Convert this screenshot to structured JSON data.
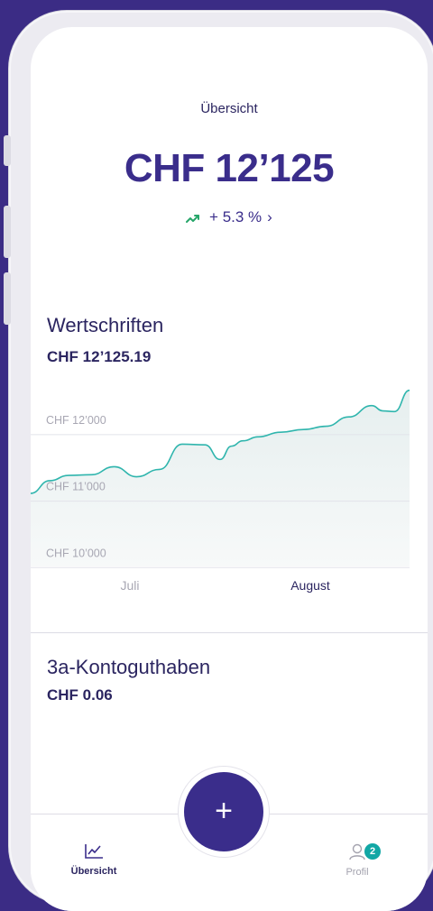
{
  "header": {
    "title": "Übersicht"
  },
  "portfolio": {
    "total": "CHF 12’125",
    "change": "+ 5.3 %",
    "chevron": "›",
    "trend_icon": "trend-up-icon"
  },
  "securities": {
    "title": "Wertschriften",
    "amount": "CHF 12’125.19"
  },
  "pillar3a": {
    "title": "3a-Kontoguthaben",
    "amount": "CHF 0.06"
  },
  "chart_data": {
    "type": "area",
    "y_tick_labels": [
      "CHF 12’000",
      "CHF 11’000",
      "CHF 10’000"
    ],
    "x_tick_labels": [
      "Juli",
      "August"
    ],
    "x": [
      0,
      0.05,
      0.1,
      0.16,
      0.22,
      0.28,
      0.34,
      0.4,
      0.46,
      0.5,
      0.53,
      0.56,
      0.6,
      0.66,
      0.72,
      0.78,
      0.84,
      0.9,
      0.93,
      0.96,
      1.0
    ],
    "values": [
      10900,
      11090,
      11170,
      11180,
      11300,
      11150,
      11260,
      11640,
      11630,
      11410,
      11610,
      11690,
      11750,
      11820,
      11860,
      11910,
      12050,
      12220,
      12140,
      12130,
      12450
    ],
    "ylim": [
      9800,
      12650
    ],
    "color": "#2fb5ad",
    "fill": "#e6efef",
    "grid": true
  },
  "tabs": [
    {
      "label": "Übersicht",
      "icon": "chart-icon",
      "active": true
    },
    {
      "label": "Profil",
      "icon": "user-icon",
      "active": false,
      "badge": "2"
    }
  ],
  "fab": {
    "label": "+"
  },
  "colors": {
    "brand": "#3a2d8b",
    "accent": "#12a7a5",
    "positive": "#27a66a",
    "background": "#3b2c85"
  }
}
